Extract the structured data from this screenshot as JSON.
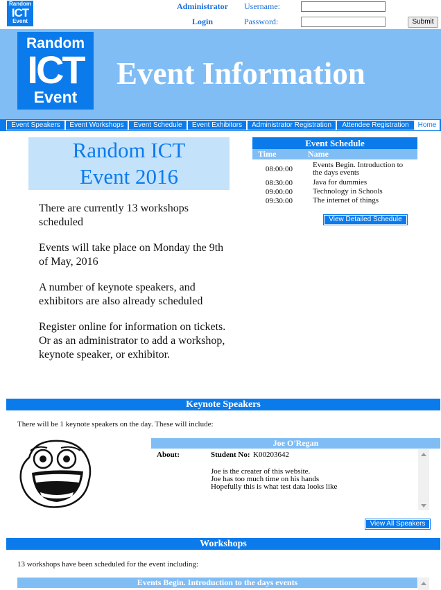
{
  "top": {
    "logo_lines": [
      "Random",
      "ICT",
      "Event"
    ],
    "admin_link": "Administrator",
    "login_link": "Login",
    "username_label": "Username:",
    "password_label": "Password:",
    "username_value": "",
    "password_value": "",
    "submit_label": "Submit"
  },
  "header": {
    "logo_lines": [
      "Random",
      "ICT",
      "Event"
    ],
    "title": "Event Information"
  },
  "nav": {
    "items": [
      "Event Speakers",
      "Event Workshops",
      "Event Schedule",
      "Event Exhibitors",
      "Administrator Registration",
      "Attendee Registration",
      "Home"
    ]
  },
  "main": {
    "title_line1": "Random ICT",
    "title_line2": "Event 2016",
    "paragraphs": [
      "There are currently 13 workshops scheduled",
      "Events will take place on Monday the 9th of May, 2016",
      "A number of keynote speakers, and exhibitors are also already scheduled",
      "Register online for information on tickets. Or as an administrator to add a workshop, keynote speaker, or exhibitor."
    ]
  },
  "schedule": {
    "title": "Event Schedule",
    "col_time": "Time",
    "col_name": "Name",
    "rows": [
      {
        "time": "08:00:00",
        "name": "Events Begin. Introduction to the days events"
      },
      {
        "time": "08:30:00",
        "name": "Java for dummies"
      },
      {
        "time": "09:00:00",
        "name": "Technology in Schools"
      },
      {
        "time": "09:30:00",
        "name": "The internet of things"
      }
    ],
    "button": "View Detailed Schedule"
  },
  "keynote": {
    "title": "Keynote Speakers",
    "intro": "There will be 1 keynote speakers on the day. These will include:",
    "speaker_name": "Joe O'Regan",
    "about_label": "About:",
    "student_no_label": "Student No:",
    "student_no": "K00203642",
    "bio_lines": [
      "Joe is the creater of this website.",
      "Joe has too much time on his hands",
      "Hopefully this is what test data looks like"
    ],
    "button": "View All Speakers"
  },
  "workshops": {
    "title": "Workshops",
    "intro": "13 workshops have been scheduled for the event including:",
    "first_title": "Events Begin. Introduction to the days events"
  },
  "colors": {
    "primary": "#0b7bec",
    "light": "#80bdf5",
    "pale": "#c5e2fb"
  }
}
